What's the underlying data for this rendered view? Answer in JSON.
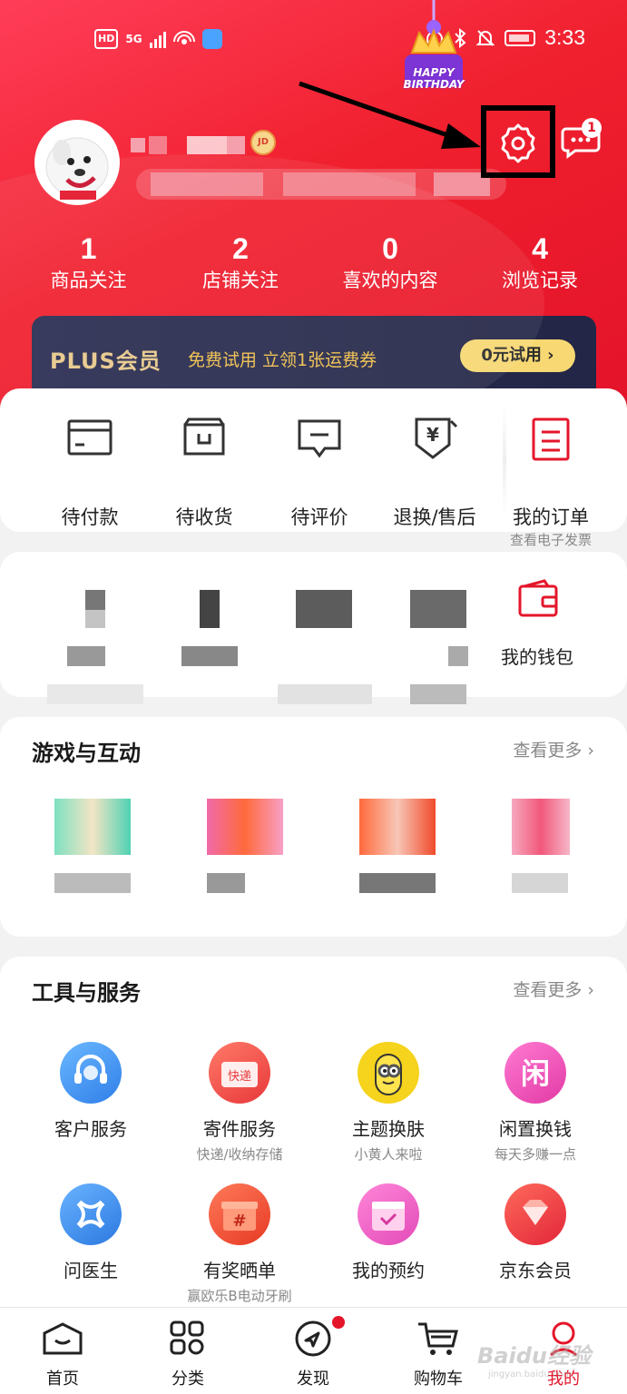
{
  "status_bar": {
    "network": "HD",
    "signal": "5G",
    "time": "3:33",
    "accent": "#ffffff"
  },
  "birthday": {
    "line1": "HAPPY",
    "line2": "BIRTHDAY"
  },
  "header": {
    "jd_badge": "JD",
    "message_count": "1"
  },
  "stats": [
    {
      "value": "1",
      "label": "商品关注"
    },
    {
      "value": "2",
      "label": "店铺关注"
    },
    {
      "value": "0",
      "label": "喜欢的内容"
    },
    {
      "value": "4",
      "label": "浏览记录"
    }
  ],
  "plus": {
    "title": "PLUS会员",
    "desc": "免费试用 立领1张运费券",
    "button": "0元试用 ›"
  },
  "orders": {
    "items": [
      {
        "label": "待付款",
        "icon": "wallet-card-icon"
      },
      {
        "label": "待收货",
        "icon": "box-icon"
      },
      {
        "label": "待评价",
        "icon": "comment-icon"
      },
      {
        "label": "退换/售后",
        "icon": "refund-shield-icon"
      }
    ],
    "my_orders": {
      "label": "我的订单",
      "sub": "查看电子发票"
    }
  },
  "wallet": {
    "label": "我的钱包"
  },
  "games": {
    "title": "游戏与互动",
    "more": "查看更多 ›"
  },
  "tools": {
    "title": "工具与服务",
    "more": "查看更多 ›",
    "items": [
      {
        "label": "客户服务",
        "sub": "",
        "icon": "headset-icon",
        "color": "#3d8ff0"
      },
      {
        "label": "寄件服务",
        "sub": "快递/收纳存储",
        "icon": "parcel-icon",
        "color": "#f0544a",
        "tag": "快递"
      },
      {
        "label": "主题换肤",
        "sub": "小黄人来啦",
        "icon": "minion-icon",
        "color": "#f6d31c"
      },
      {
        "label": "闲置换钱",
        "sub": "每天多赚一点",
        "icon": "idle-trade-icon",
        "color": "#f04fb3",
        "tag": "闲"
      },
      {
        "label": "问医生",
        "sub": "",
        "icon": "doctor-icon",
        "color": "#3f8ff0"
      },
      {
        "label": "有奖晒单",
        "sub": "赢欧乐B电动牙刷",
        "icon": "gift-icon",
        "color": "#f0544a",
        "tag": "#"
      },
      {
        "label": "我的预约",
        "sub": "",
        "icon": "calendar-icon",
        "color": "#f15bc0"
      },
      {
        "label": "京东会员",
        "sub": "",
        "icon": "diamond-icon",
        "color": "#f04040"
      }
    ]
  },
  "tabbar": [
    {
      "label": "首页",
      "icon": "home-icon"
    },
    {
      "label": "分类",
      "icon": "category-icon"
    },
    {
      "label": "发现",
      "icon": "discover-icon"
    },
    {
      "label": "购物车",
      "icon": "cart-icon"
    },
    {
      "label": "我的",
      "icon": "profile-icon"
    }
  ],
  "watermark": {
    "main": "Baidu经验",
    "sub": "jingyan.baidu.com"
  }
}
